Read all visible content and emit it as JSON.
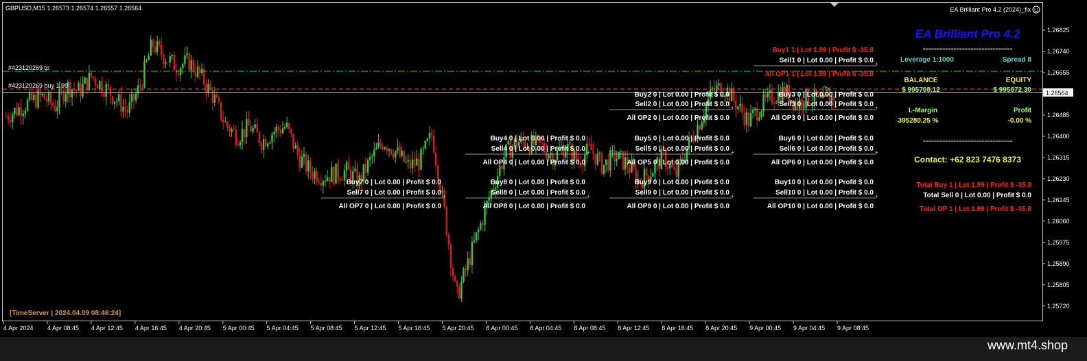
{
  "header": {
    "symbol_info": "GBPUSD,M15  1.26573 1.26574 1.26557 1.26564",
    "ea_name_tag": "EA Brilliant Pro 4.2 (2024)_fix"
  },
  "lines": {
    "tp_label": "#423120269 tp",
    "buy_label": "#423120269 buy 1.99",
    "current_price": "1.26564"
  },
  "time_server": "[TimeServer | 2024.04.09 08:46:24]",
  "panel": {
    "title": "EA Brilliant Pro 4.2",
    "separator": "================================",
    "leverage": "Leverage  1:1000",
    "spread": "Spread   8",
    "balance_label": "BALANCE",
    "equity_label": "EQUITY",
    "balance_value": "$ 995708.12",
    "equity_value": "$ 995672.30",
    "lmargin_label": "L-Margin",
    "profit_label": "Profit",
    "lmargin_value": "395280.25 %",
    "profit_value": "-0.00 %",
    "contact": "Contact: +62 823 7476 8373",
    "total_buy": "Total Buy   1  |  Lot 1.99  |  Profit $ -35.8",
    "total_sell": "Total Sell   0  |  Lot 0.00  |  Profit $ 0.0",
    "total_op": "Total OP   1  |  Lot 1.99  |  Profit $ -35.8"
  },
  "order_blocks": [
    {
      "buy": "Buy1   1  |  Lot 1.99  |  Profit $ -35.8",
      "sell": "Sell1   0  |  Lot 0.00  |  Profit $ 0.0",
      "all": "All OP1   1  |  Lot 1.99  |  Profit $ -35.8",
      "active": true
    },
    {
      "buy": "Buy2   0  |  Lot 0.00  |  Profit $ 0.0",
      "sell": "Sell2   0  |  Lot 0.00  |  Profit $ 0.0",
      "all": "All OP2   0  |  Lot 0.00  |  Profit $ 0.0",
      "active": false
    },
    {
      "buy": "Buy3   0  |  Lot 0.00  |  Profit $ 0.0",
      "sell": "Sell3   0  |  Lot 0.00  |  Profit $ 0.0",
      "all": "All OP3   0  |  Lot 0.00  |  Profit $ 0.0",
      "active": false
    },
    {
      "buy": "Buy4   0  |  Lot 0.00  |  Profit $ 0.0",
      "sell": "Sell4   0  |  Lot 0.00  |  Profit $ 0.0",
      "all": "All OP4   0  |  Lot 0.00  |  Profit $ 0.0",
      "active": false
    },
    {
      "buy": "Buy5   0  |  Lot 0.00  |  Profit $ 0.0",
      "sell": "Sell5   0  |  Lot 0.00  |  Profit $ 0.0",
      "all": "All OP5   0  |  Lot 0.00  |  Profit $ 0.0",
      "active": false
    },
    {
      "buy": "Buy6   0  |  Lot 0.00  |  Profit $ 0.0",
      "sell": "Sell6   0  |  Lot 0.00  |  Profit $ 0.0",
      "all": "All OP6   0  |  Lot 0.00  |  Profit $ 0.0",
      "active": false
    },
    {
      "buy": "Buy7   0  |  Lot 0.00  |  Profit $ 0.0",
      "sell": "Sell7   0  |  Lot 0.00  |  Profit $ 0.0",
      "all": "All OP7   0  |  Lot 0.00  |  Profit $ 0.0",
      "active": false
    },
    {
      "buy": "Buy8   0  |  Lot 0.00  |  Profit $ 0.0",
      "sell": "Sell8   0  |  Lot 0.00  |  Profit $ 0.0",
      "all": "All OP8   0  |  Lot 0.00  |  Profit $ 0.0",
      "active": false
    },
    {
      "buy": "Buy9   0  |  Lot 0.00  |  Profit $ 0.0",
      "sell": "Sell9   0  |  Lot 0.00  |  Profit $ 0.0",
      "all": "All OP9   0  |  Lot 0.00  |  Profit $ 0.0",
      "active": false
    },
    {
      "buy": "Buy10   0  |  Lot 0.00  |  Profit $ 0.0",
      "sell": "Sell10   0  |  Lot 0.00  |  Profit $ 0.0",
      "all": "All OP10   0  |  Lot 0.00  |  Profit $ 0.0",
      "active": false
    }
  ],
  "footer": {
    "brand": "www.mt4.shop"
  },
  "colors": {
    "background": "#000000",
    "bull": "#2ecc40",
    "bear": "#e8141c",
    "title_blue": "#1414ff",
    "cyan": "#40e0d0",
    "yellow": "#f5f51e",
    "green_text": "#9aff70",
    "red_text": "#ff2020",
    "time_server": "#d2a040"
  },
  "chart_data": {
    "type": "candlestick",
    "symbol": "GBPUSD",
    "timeframe": "M15",
    "ylim": [
      1.2567,
      1.2685
    ],
    "y_ticks": [
      "1.26825",
      "1.26740",
      "1.26655",
      "1.26485",
      "1.26400",
      "1.26315",
      "1.26230",
      "1.26145",
      "1.26060",
      "1.25975",
      "1.25890",
      "1.25805",
      "1.25720"
    ],
    "x_ticks": [
      "4 Apr 2024",
      "4 Apr 08:45",
      "4 Apr 12:45",
      "4 Apr 16:45",
      "4 Apr 20:45",
      "5 Apr 00:45",
      "5 Apr 04:45",
      "5 Apr 08:45",
      "5 Apr 12:45",
      "5 Apr 16:45",
      "5 Apr 20:45",
      "8 Apr 00:45",
      "8 Apr 04:45",
      "8 Apr 08:45",
      "8 Apr 12:45",
      "8 Apr 16:45",
      "8 Apr 20:45",
      "9 Apr 00:45",
      "9 Apr 04:45",
      "9 Apr 08:45"
    ],
    "tp_price": 1.26655,
    "buy_price": 1.26575,
    "bid_price": 1.26564,
    "path": [
      1.2648,
      1.2651,
      1.2654,
      1.2656,
      1.2652,
      1.266,
      1.2658,
      1.2664,
      1.266,
      1.2655,
      1.265,
      1.266,
      1.2677,
      1.2672,
      1.2668,
      1.267,
      1.2664,
      1.2656,
      1.2645,
      1.264,
      1.2644,
      1.2638,
      1.2642,
      1.2644,
      1.2632,
      1.2626,
      1.2624,
      1.2625,
      1.2626,
      1.2622,
      1.2631,
      1.2638,
      1.2634,
      1.2628,
      1.263,
      1.2641,
      1.261,
      1.2575,
      1.259,
      1.2605,
      1.262,
      1.2633,
      1.2638,
      1.2637,
      1.2636,
      1.2632,
      1.2636,
      1.263,
      1.2635,
      1.2628,
      1.2632,
      1.2629,
      1.2622,
      1.2626,
      1.2632,
      1.2624,
      1.2636,
      1.2646,
      1.2658,
      1.266,
      1.2653,
      1.2646,
      1.2652,
      1.2656,
      1.2658,
      1.2653,
      1.2656,
      1.2653,
      1.2656
    ]
  }
}
